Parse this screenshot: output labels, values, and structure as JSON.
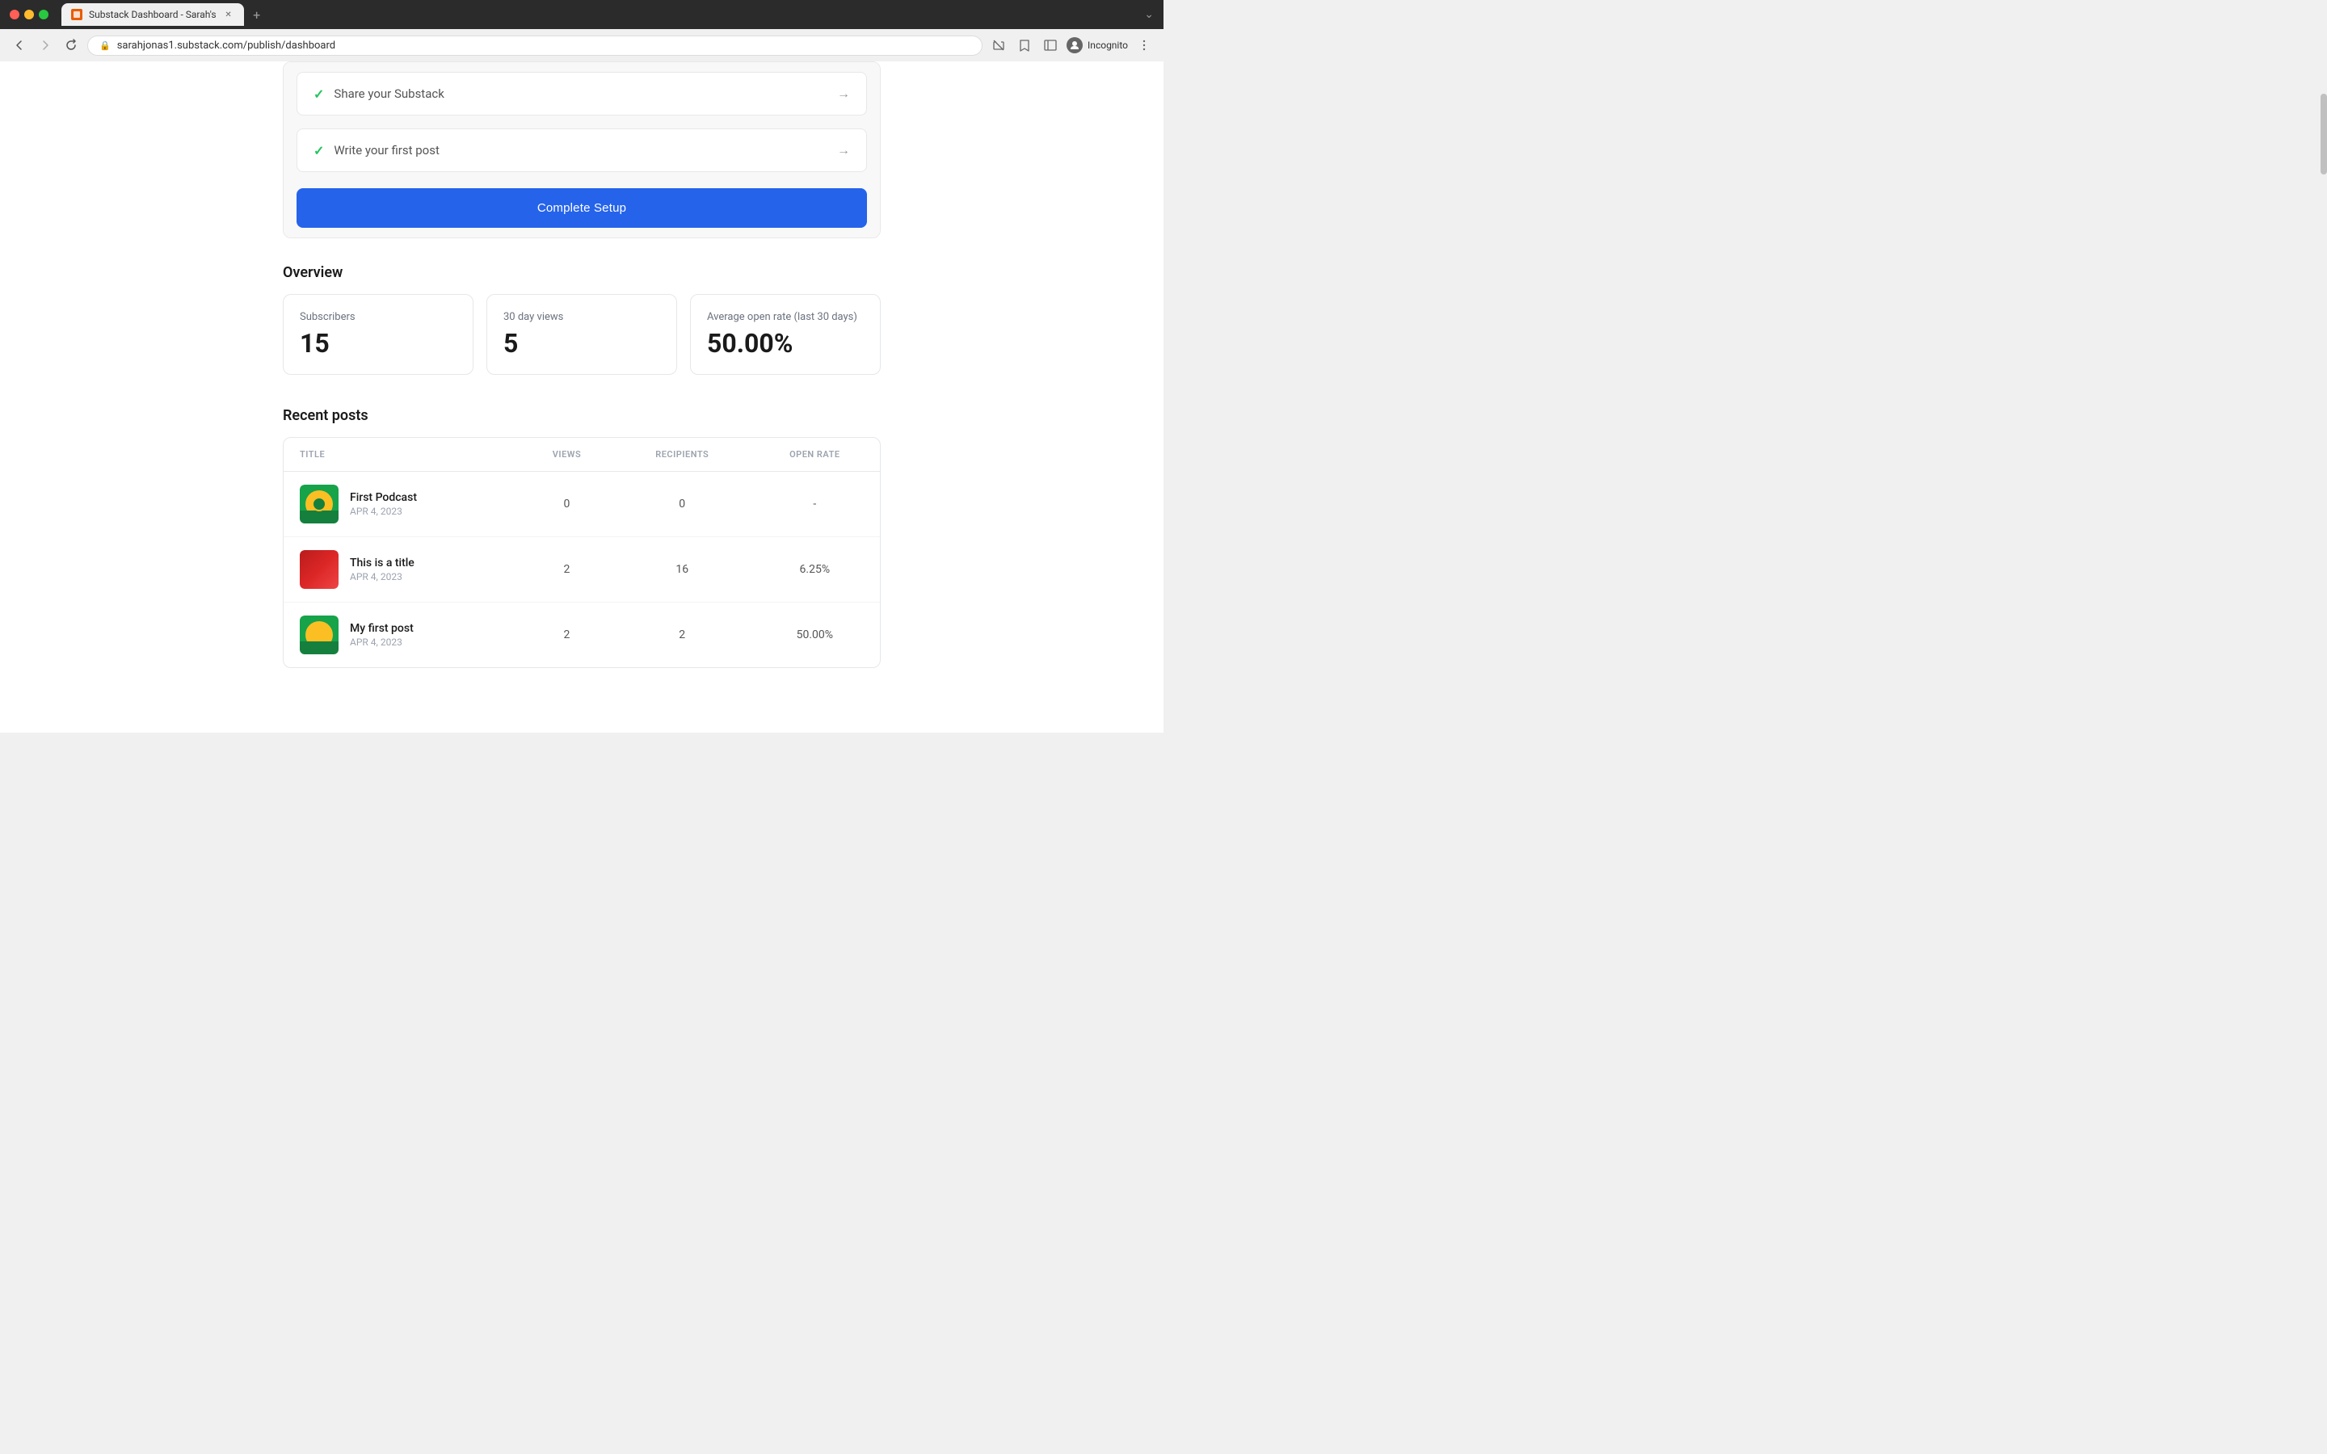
{
  "browser": {
    "tab_title": "Substack Dashboard - Sarah's",
    "url": "sarahjonas1.substack.com/publish/dashboard",
    "incognito_label": "Incognito"
  },
  "setup": {
    "items": [
      {
        "label": "Share your Substack",
        "completed": true
      },
      {
        "label": "Write your first post",
        "completed": true
      }
    ],
    "complete_button": "Complete Setup"
  },
  "overview": {
    "section_title": "Overview",
    "stats": [
      {
        "label": "Subscribers",
        "value": "15"
      },
      {
        "label": "30 day views",
        "value": "5"
      },
      {
        "label": "Average open rate (last 30 days)",
        "value": "50.00%"
      }
    ]
  },
  "recent_posts": {
    "section_title": "Recent posts",
    "columns": {
      "title": "TITLE",
      "views": "VIEWS",
      "recipients": "RECIPIENTS",
      "open_rate": "OPEN RATE"
    },
    "posts": [
      {
        "id": "post-1",
        "title": "First Podcast",
        "date": "APR 4, 2023",
        "views": "0",
        "recipients": "0",
        "open_rate": "-",
        "thumb_type": "podcast"
      },
      {
        "id": "post-2",
        "title": "This is a title",
        "date": "APR 4, 2023",
        "views": "2",
        "recipients": "16",
        "open_rate": "6.25%",
        "thumb_type": "flowers"
      },
      {
        "id": "post-3",
        "title": "My first post",
        "date": "APR 4, 2023",
        "views": "2",
        "recipients": "2",
        "open_rate": "50.00%",
        "thumb_type": "yellow"
      }
    ]
  }
}
